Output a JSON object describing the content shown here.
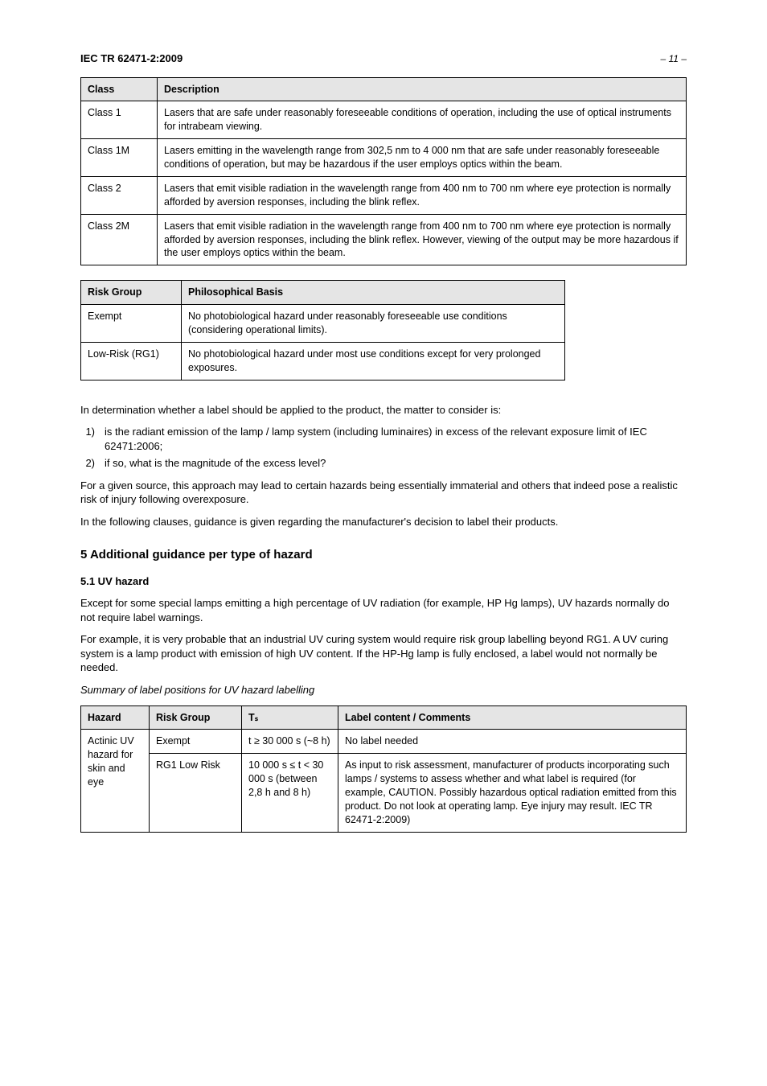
{
  "header": {
    "left": "IEC TR 62471-2:2009",
    "right": "– 11 –"
  },
  "table1": {
    "headers": {
      "c1": "Class",
      "c2": "Description"
    },
    "rows": [
      {
        "c1": "Class 1",
        "c2": "Lasers that are safe under reasonably foreseeable conditions of operation, including the use of optical instruments for intrabeam viewing."
      },
      {
        "c1": "Class 1M",
        "c2": "Lasers emitting in the wavelength range from 302,5 nm to 4 000 nm that are safe under reasonably foreseeable conditions of operation, but may be hazardous if the user employs optics within the beam."
      },
      {
        "c1": "Class 2",
        "c2": "Lasers that emit visible radiation in the wavelength range from 400 nm to 700 nm where eye protection is normally afforded by aversion responses, including the blink reflex."
      },
      {
        "c1": "Class 2M",
        "c2": "Lasers that emit visible radiation in the wavelength range from 400 nm to 700 nm where eye protection is normally afforded by aversion responses, including the blink reflex. However, viewing of the output may be more hazardous if the user employs optics within the beam."
      }
    ]
  },
  "table2": {
    "headers": {
      "c1": "Risk Group",
      "c2": "Philosophical Basis"
    },
    "rows": [
      {
        "c1": "Exempt",
        "c2": "No photobiological hazard under reasonably foreseeable use conditions (considering operational limits)."
      },
      {
        "c1": "Low-Risk (RG1)",
        "c2": "No photobiological hazard under most use conditions except for very prolonged exposures."
      }
    ]
  },
  "labellingText": {
    "p1": "In determination whether a label should be applied to the product, the matter to consider is:",
    "i1": {
      "lbl": "1)",
      "txt": "is the radiant emission of the lamp / lamp system (including luminaires) in excess of the relevant exposure limit of IEC 62471:2006;"
    },
    "i2": {
      "lbl": "2)",
      "txt": "if so, what is the magnitude of the excess level?"
    },
    "p2": "For a given source, this approach may lead to certain hazards being essentially immaterial and others that indeed pose a realistic risk of injury following overexposure.",
    "p3": "In the following clauses, guidance is given regarding the manufacturer's decision to label their products."
  },
  "section5": {
    "heading": "5  Additional guidance per type of hazard",
    "sub1": "5.1  UV hazard",
    "p1": "Except for some special lamps emitting a high percentage of UV radiation (for example, HP Hg lamps), UV hazards normally do not require label warnings.",
    "p2": "For example, it is very probable that an industrial UV curing system would require risk group labelling beyond RG1. A UV curing system is a lamp product with emission of high UV content. If the HP-Hg lamp is fully enclosed, a label would not normally be needed.",
    "subTable3_caption": "Summary of label positions for UV hazard labelling",
    "table3": {
      "headers": {
        "c1": "Hazard",
        "c2": "Risk Group",
        "c3": "Tₛ",
        "c4": "Label content / Comments"
      },
      "rows": [
        {
          "c1": "Actinic UV hazard for skin and eye",
          "c2": "Exempt",
          "c3": "t ≥ 30 000 s (~8 h)",
          "c4": "No label needed"
        },
        {
          "c1_rowspan": true,
          "c2": "RG1 Low Risk",
          "c3": "10 000 s ≤ t < 30 000 s (between 2,8 h and 8 h)",
          "c4": "As input to risk assessment, manufacturer of products incorporating such lamps / systems to assess whether and what label is required (for example,  CAUTION. Possibly hazardous optical radiation emitted from this product. Do not look at operating lamp. Eye injury may result. IEC TR 62471-2:2009)"
        }
      ]
    }
  }
}
